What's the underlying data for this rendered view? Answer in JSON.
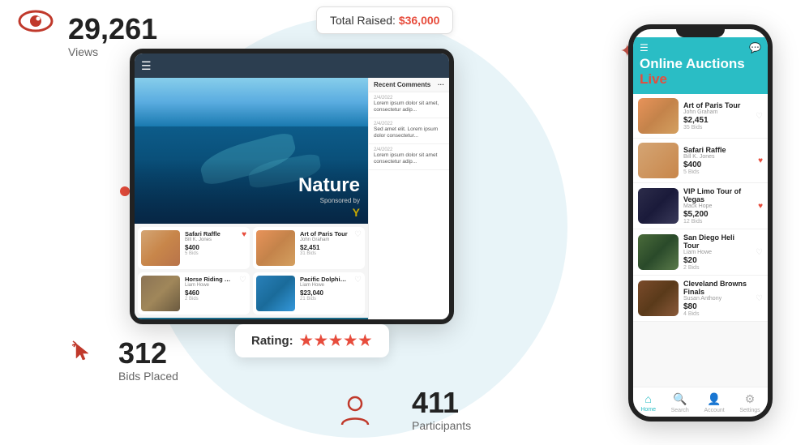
{
  "stats": {
    "views_number": "29,261",
    "views_label": "Views",
    "bids_number": "312",
    "bids_label": "Bids Placed",
    "participants_number": "411",
    "participants_label": "Participants"
  },
  "total_raised": {
    "label": "Total Raised:",
    "amount": "$36,000"
  },
  "rating": {
    "label": "Rating:"
  },
  "tablet": {
    "hero_title": "Nature",
    "sponsored_label": "Sponsored by",
    "sidebar_header": "Recent Comments",
    "comments": [
      {
        "date": "2/4/2022",
        "text": "Lorem ipsum dolor sit amet, consectetur adipiscing elit. Sed ut..."
      },
      {
        "date": "2/4/2022",
        "text": "Sed amet elit. Lorem ipsum dolor consectetur adipiscing..."
      },
      {
        "date": "2/4/2022",
        "text": "Lorem ipsum dolor sit amet consectetur adipiscing elit. Quo..."
      }
    ],
    "cards": [
      {
        "name": "Safari Raffle",
        "author": "Bill K. Jones",
        "price": "$400",
        "bids": "5 Bids",
        "heart": true
      },
      {
        "name": "Art of Paris Tour",
        "author": "John Graham",
        "price": "$2,451",
        "bids": "31 Bids",
        "heart": false
      },
      {
        "name": "Horse Riding Sessions",
        "author": "Liam Howe",
        "price": "$460",
        "bids": "2 Bids",
        "heart": false
      },
      {
        "name": "Pacific Dolphin Watch",
        "author": "Liam Howe",
        "price": "$23,040",
        "bids": "21 Bids",
        "heart": false
      }
    ]
  },
  "phone": {
    "title_main": "Online Auctions",
    "title_live": "Live",
    "items": [
      {
        "name": "Art of Paris Tour",
        "author": "John Graham",
        "price": "$2,451",
        "bids": "35 Bids",
        "heart": false,
        "img": "paris"
      },
      {
        "name": "Safari Raffle",
        "author": "Bill K. Jones",
        "price": "$400",
        "bids": "5 Bids",
        "heart": true,
        "img": "camel"
      },
      {
        "name": "VIP Limo Tour of Vegas",
        "author": "Mack Hope",
        "price": "$5,200",
        "bids": "12 Bids",
        "heart": true,
        "img": "vegas"
      },
      {
        "name": "San Diego Heli Tour",
        "author": "Liam Howe",
        "price": "$20",
        "bids": "2 Bids",
        "heart": false,
        "img": "heli"
      },
      {
        "name": "Cleveland Browns Finals",
        "author": "Susan Anthony",
        "price": "$80",
        "bids": "4 Bids",
        "heart": false,
        "img": "browns"
      }
    ],
    "nav": [
      {
        "label": "Home",
        "active": true
      },
      {
        "label": "Search",
        "active": false
      },
      {
        "label": "Account",
        "active": false
      },
      {
        "label": "Settings",
        "active": false
      }
    ]
  }
}
